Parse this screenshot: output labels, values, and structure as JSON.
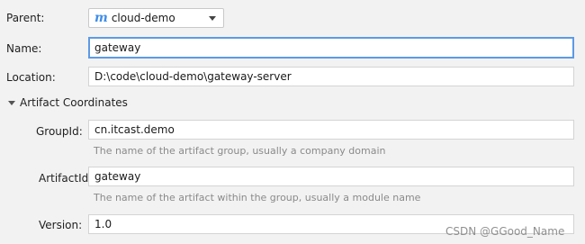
{
  "form": {
    "parent": {
      "label": "Parent:",
      "value": "cloud-demo",
      "icon": "maven-module-icon"
    },
    "name": {
      "label": "Name:",
      "value": "gateway"
    },
    "location": {
      "label": "Location:",
      "value": "D:\\code\\cloud-demo\\gateway-server"
    }
  },
  "artifact": {
    "section_title": "Artifact Coordinates",
    "group_id": {
      "label": "GroupId:",
      "value": "cn.itcast.demo",
      "hint": "The name of the artifact group, usually a company domain"
    },
    "artifact_id": {
      "label": "ArtifactId:",
      "value": "gateway",
      "hint": "The name of the artifact within the group, usually a module name"
    },
    "version": {
      "label": "Version:",
      "value": "1.0"
    }
  },
  "watermark": "CSDN @GGood_Name",
  "colors": {
    "focus_border": "#5c9ae6",
    "maven_icon": "#3f8de8",
    "background": "#f2f2f2"
  }
}
